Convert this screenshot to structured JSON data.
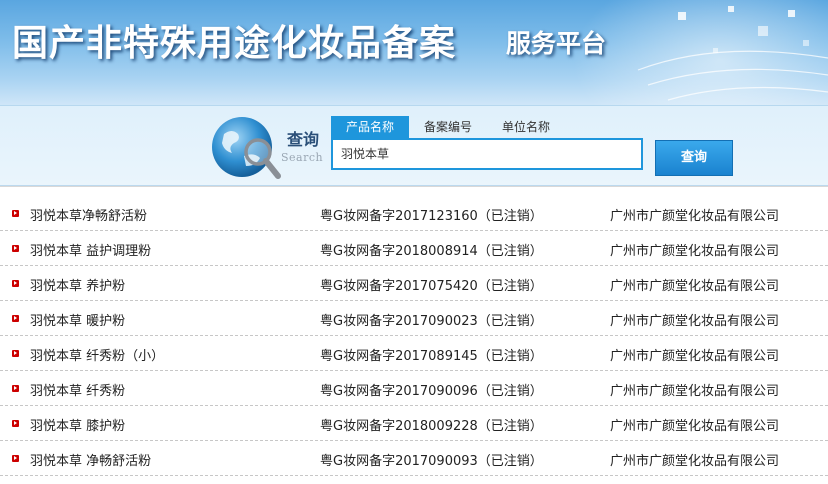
{
  "header": {
    "title": "国产非特殊用途化妆品备案",
    "subtitle": "服务平台"
  },
  "search": {
    "label_cn": "查询",
    "label_en": "Search",
    "tabs": [
      {
        "label": "产品名称",
        "active": true
      },
      {
        "label": "备案编号",
        "active": false
      },
      {
        "label": "单位名称",
        "active": false
      }
    ],
    "input_value": "羽悦本草",
    "button_label": "查询"
  },
  "results": [
    {
      "product": "羽悦本草净畅舒活粉",
      "record": "粤G妆网备字2017123160（已注销）",
      "company": "广州市广颜堂化妆品有限公司"
    },
    {
      "product": "羽悦本草 益护调理粉",
      "record": "粤G妆网备字2018008914（已注销）",
      "company": "广州市广颜堂化妆品有限公司"
    },
    {
      "product": "羽悦本草 养护粉",
      "record": "粤G妆网备字2017075420（已注销）",
      "company": "广州市广颜堂化妆品有限公司"
    },
    {
      "product": "羽悦本草 暖护粉",
      "record": "粤G妆网备字2017090023（已注销）",
      "company": "广州市广颜堂化妆品有限公司"
    },
    {
      "product": "羽悦本草 纤秀粉（小）",
      "record": "粤G妆网备字2017089145（已注销）",
      "company": "广州市广颜堂化妆品有限公司"
    },
    {
      "product": "羽悦本草 纤秀粉",
      "record": "粤G妆网备字2017090096（已注销）",
      "company": "广州市广颜堂化妆品有限公司"
    },
    {
      "product": "羽悦本草 膝护粉",
      "record": "粤G妆网备字2018009228（已注销）",
      "company": "广州市广颜堂化妆品有限公司"
    },
    {
      "product": "羽悦本草 净畅舒活粉",
      "record": "粤G妆网备字2017090093（已注销）",
      "company": "广州市广颜堂化妆品有限公司"
    }
  ]
}
